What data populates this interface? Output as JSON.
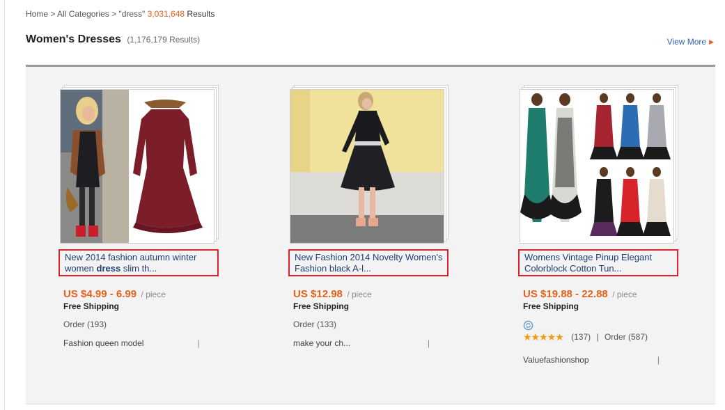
{
  "breadcrumb": {
    "home": "Home",
    "sep1": ">",
    "all_categories": "All Categories",
    "sep2": ">",
    "query": "\"dress\"",
    "count": "3,031,648",
    "results_label": "Results"
  },
  "section": {
    "title": "Women's Dresses",
    "subtitle": "(1,176,179 Results)",
    "view_more": "View More"
  },
  "products": [
    {
      "title_part1": "New 2014 fashion autumn winter women ",
      "title_bold": "dress",
      "title_part2": " slim th...",
      "price": "US $4.99 - 6.99",
      "unit": "/ piece",
      "shipping": "Free Shipping",
      "orders": "Order (193)",
      "store": "Fashion queen model",
      "separator": "|"
    },
    {
      "title": "New Fashion 2014 Novelty Women's Fashion black A-l...",
      "price": "US $12.98",
      "unit": "/ piece",
      "shipping": "Free Shipping",
      "orders": "Order (133)",
      "store": "make your ch...",
      "separator": "|"
    },
    {
      "title": "Womens Vintage Pinup Elegant Colorblock Cotton Tun...",
      "price": "US $19.88 - 22.88",
      "unit": "/ piece",
      "shipping": "Free Shipping",
      "stars": "★★★★★",
      "rating_count": "(137)",
      "rating_sep": "|",
      "orders": "Order (587)",
      "store": "Valuefashionshop",
      "separator": "|"
    }
  ],
  "icons": {
    "view_more_arrow": "caret-right-icon",
    "badge": "refresh-badge-icon",
    "stars": "star-icon"
  },
  "colors": {
    "accent_orange": "#e5611a",
    "link_blue": "#2b62a8",
    "highlight_red": "#e0202a",
    "star": "#f29a0d",
    "panel_bg": "#f3f3f3"
  }
}
